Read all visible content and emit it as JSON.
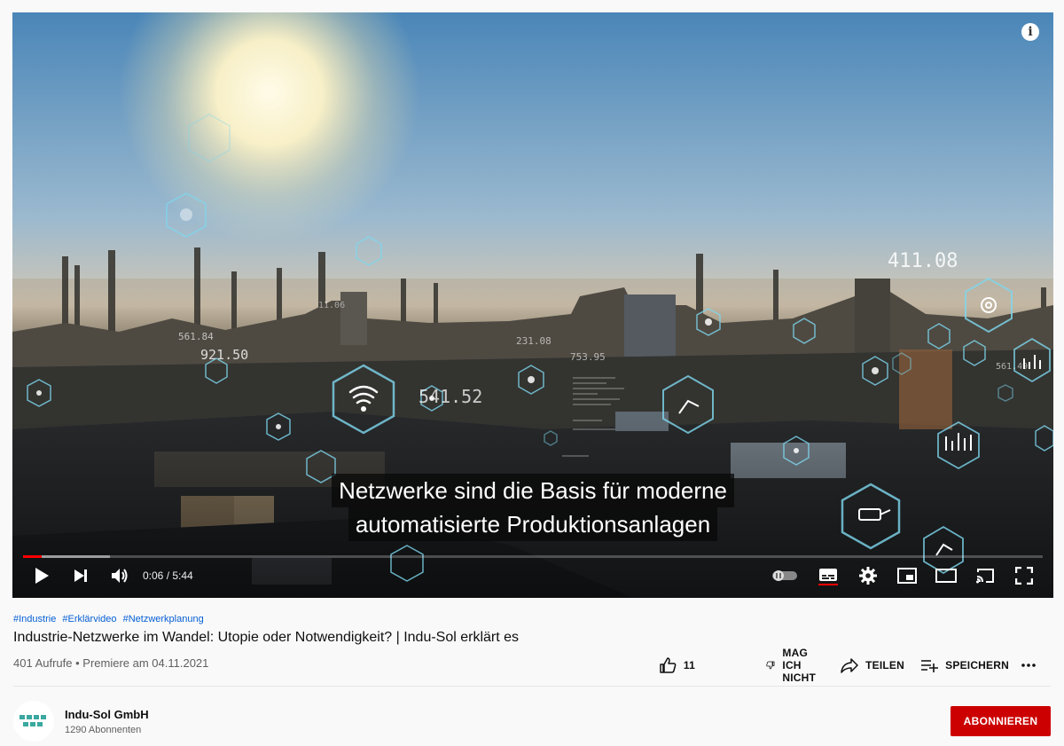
{
  "video": {
    "subtitle_line1": "Netzwerke sind die Basis für moderne",
    "subtitle_line2": "automatisierte Produktionsanlagen",
    "overlay_numbers": [
      "411.08",
      "541.52",
      "921.50",
      "561.84",
      "753.95",
      "231.08",
      "11.06",
      "561.49"
    ],
    "progress_fraction": 0.018,
    "buffered_fraction": 0.085,
    "time": "0:06 / 5:44"
  },
  "hashtags": [
    "#Industrie",
    "#Erklärvideo",
    "#Netzwerkplanung"
  ],
  "title": "Industrie-Netzwerke im Wandel: Utopie oder Notwendigkeit? | Indu-Sol erklärt es",
  "meta": "401 Aufrufe • Premiere am 04.11.2021",
  "actions": {
    "like_count": "11",
    "dislike": "MAG ICH NICHT",
    "share": "TEILEN",
    "save": "SPEICHERN"
  },
  "channel": {
    "name": "Indu-Sol GmbH",
    "subscribers": "1290 Abonnenten",
    "subscribe_label": "ABONNIEREN"
  },
  "colors": {
    "accent_red": "#cc0000",
    "progress_red": "#ff0000",
    "hashtag_blue": "#065fd4",
    "hex_cyan": "#7fd8ef"
  }
}
